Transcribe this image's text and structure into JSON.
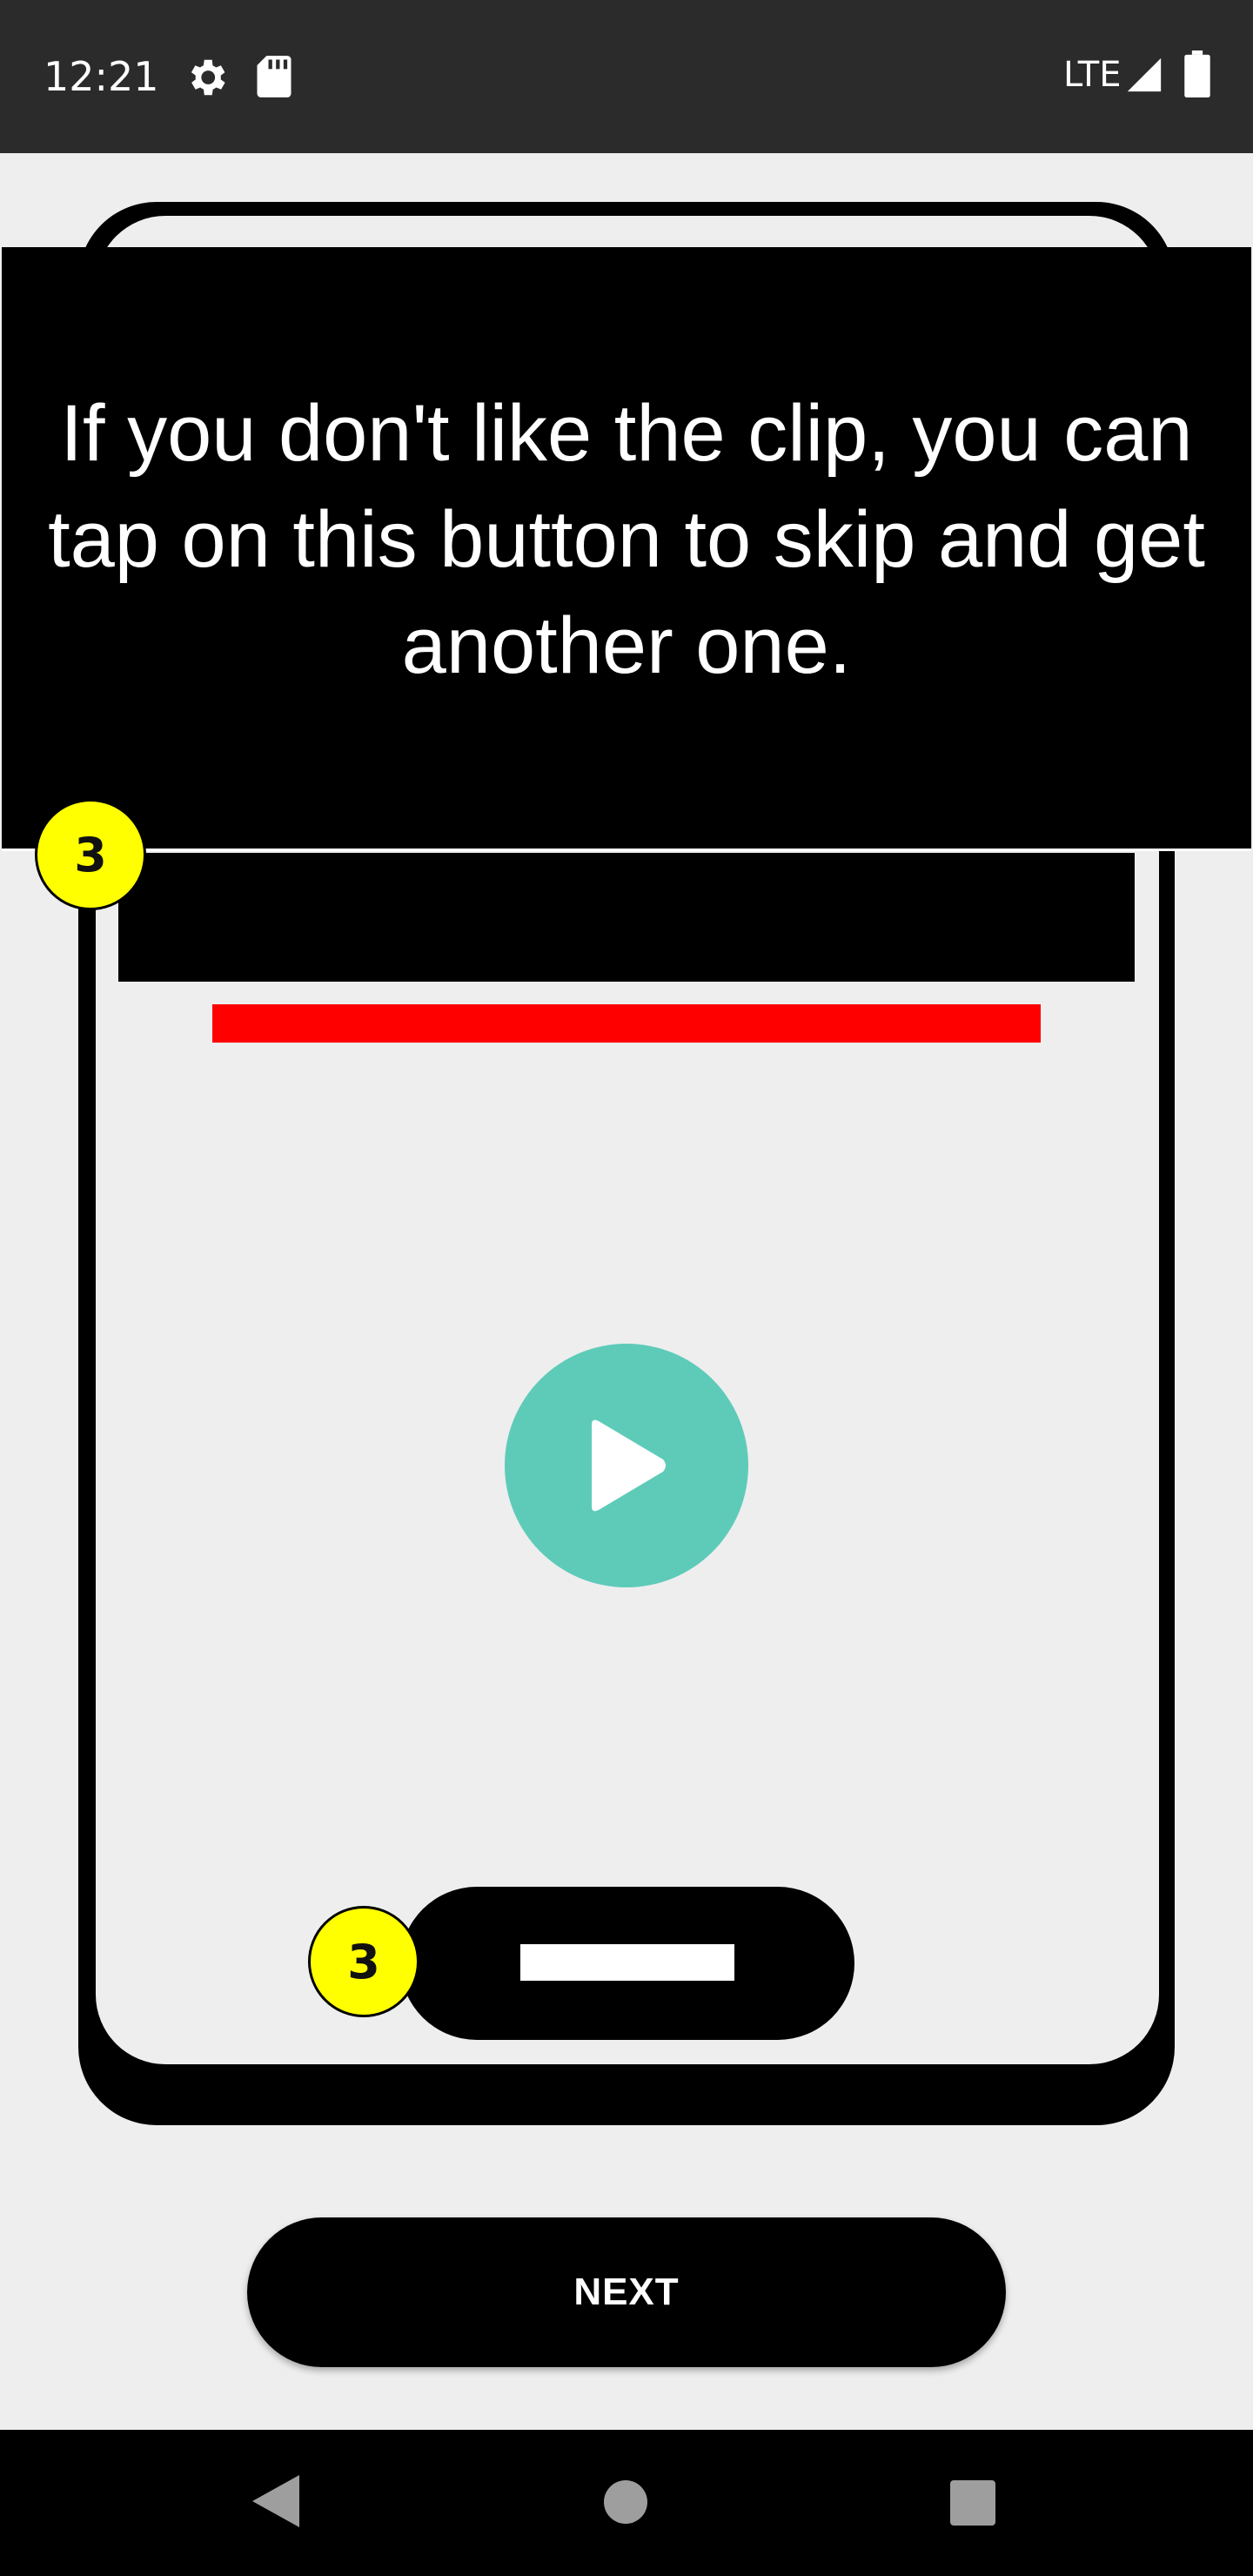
{
  "status_bar": {
    "time": "12:21",
    "network_label": "LTE",
    "icons": [
      "gear-icon",
      "sd-card-icon",
      "signal-icon",
      "battery-icon"
    ]
  },
  "tooltip": {
    "text": "If you don't like the clip, you can tap on this button to skip and get another one."
  },
  "badges": {
    "top": "3",
    "bottom": "3"
  },
  "next_button": {
    "label": "NEXT"
  },
  "nav_bar": {
    "icons": [
      "back-icon",
      "home-icon",
      "recents-icon"
    ]
  },
  "colors": {
    "accent": "#5ecbb9",
    "badge": "#ffff00",
    "progress_bar": "#ff0000",
    "background": "#eeeeee",
    "status_bar": "#2b2b2b"
  }
}
